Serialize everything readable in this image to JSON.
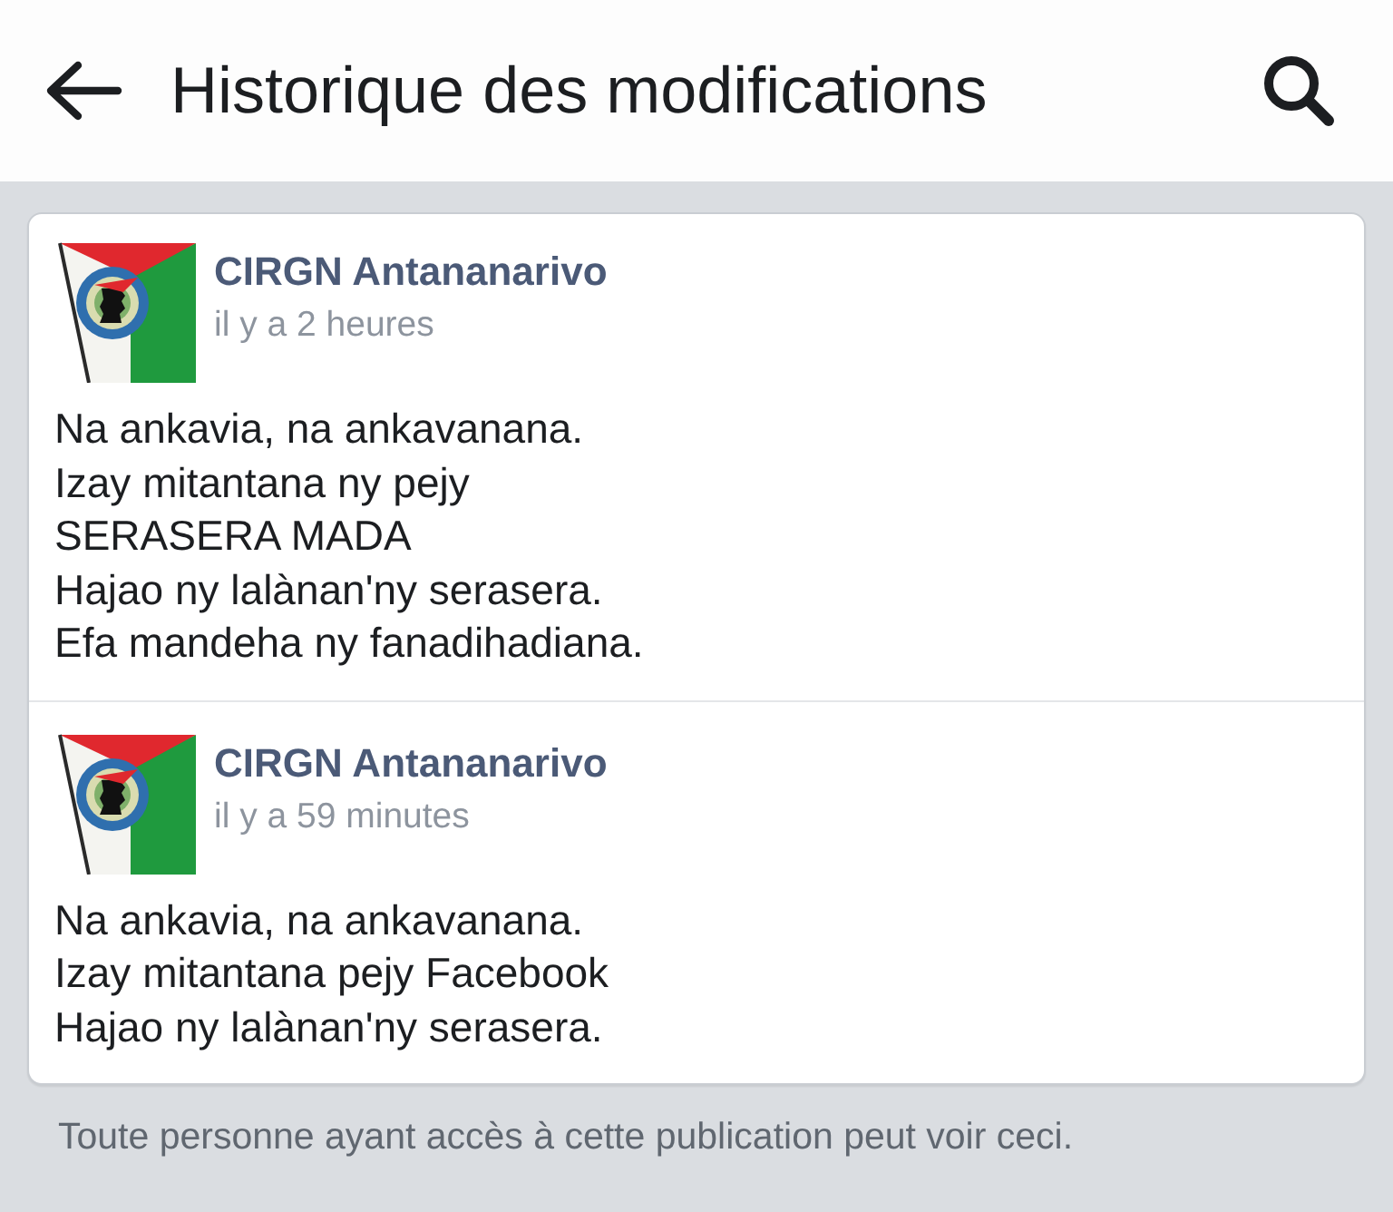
{
  "header": {
    "title": "Historique des modifications"
  },
  "revisions": [
    {
      "author": "CIRGN Antananarivo",
      "time": "il y a 2 heures",
      "lines": [
        "Na ankavia, na ankavanana.",
        "Izay mitantana ny pejy",
        "SERASERA MADA",
        "Hajao ny lalànan'ny serasera.",
        "Efa mandeha ny fanadihadiana."
      ]
    },
    {
      "author": "CIRGN Antananarivo",
      "time": "il y a 59 minutes",
      "lines": [
        "Na ankavia, na ankavanana.",
        "Izay mitantana pejy Facebook",
        "Hajao ny lalànan'ny serasera."
      ]
    }
  ],
  "footer": "Toute personne ayant accès à cette publication peut voir ceci."
}
